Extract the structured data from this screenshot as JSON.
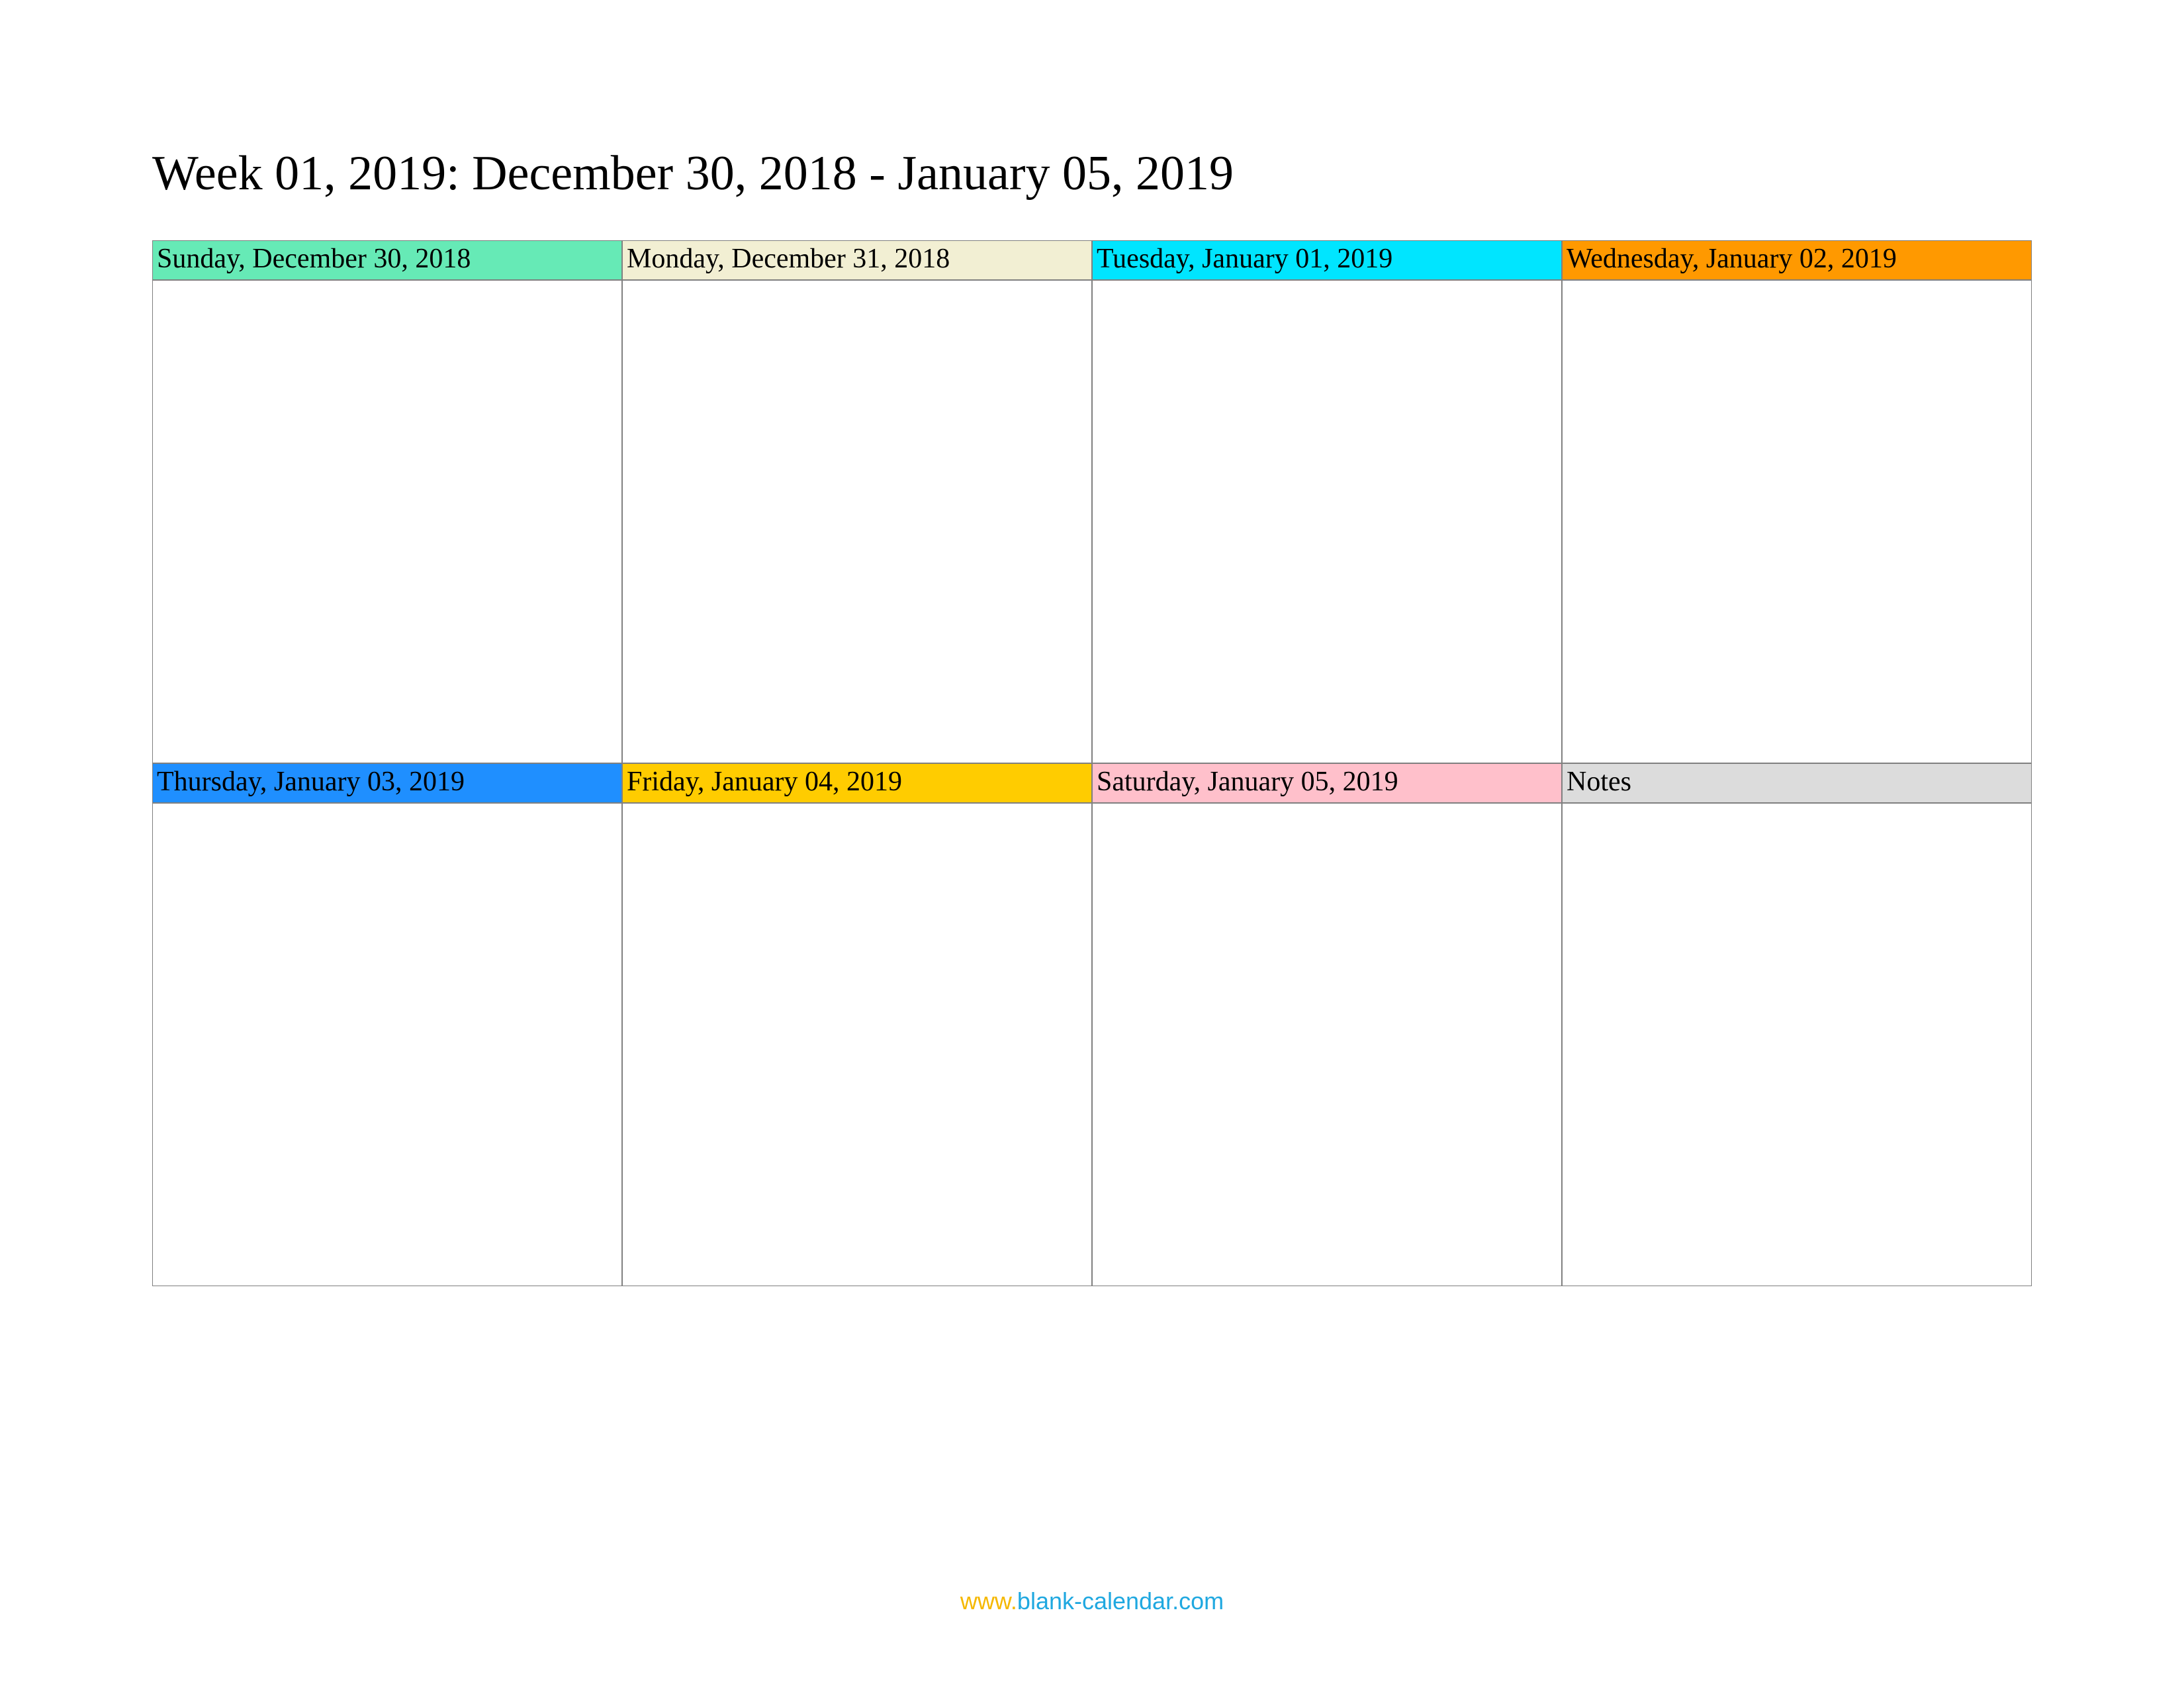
{
  "title": "Week 01, 2019: December 30, 2018 - January 05, 2019",
  "days": [
    {
      "label": "Sunday, December 30, 2018",
      "bg": "#66eab6"
    },
    {
      "label": "Monday, December 31, 2018",
      "bg": "#f2efd3"
    },
    {
      "label": "Tuesday, January 01, 2019",
      "bg": "#00e5ff"
    },
    {
      "label": "Wednesday, January 02, 2019",
      "bg": "#ff9900"
    },
    {
      "label": "Thursday, January 03, 2019",
      "bg": "#1f8fff"
    },
    {
      "label": "Friday, January 04, 2019",
      "bg": "#ffcc00"
    },
    {
      "label": "Saturday, January 05, 2019",
      "bg": "#ffc0cb"
    },
    {
      "label": "Notes",
      "bg": "#dcdcdc"
    }
  ],
  "footer": {
    "www": "www.",
    "domain": "blank-calendar.com"
  }
}
